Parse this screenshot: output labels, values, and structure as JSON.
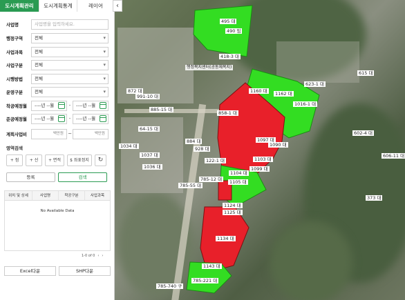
{
  "tabs": [
    {
      "label": "도시계획관리",
      "active": true
    },
    {
      "label": "도시계획통계",
      "active": false
    },
    {
      "label": "레이어",
      "active": false
    }
  ],
  "collapse_icon": "chevron-left-icon",
  "form": {
    "project_name": {
      "label": "사업명",
      "placeholder": "사업명을 입력하세요."
    },
    "district": {
      "label": "행정구역",
      "value": "전체"
    },
    "business_type": {
      "label": "사업과목",
      "value": "전체"
    },
    "business_category": {
      "label": "사업구분",
      "value": "전체"
    },
    "executor": {
      "label": "시행방법",
      "value": "전체"
    },
    "operation": {
      "label": "운영구분",
      "value": "전체"
    },
    "start_date": {
      "label": "착공예정월",
      "from": "----년 --월",
      "to": "----년 --월"
    },
    "completion_date": {
      "label": "준공예정월",
      "from": "----년 --월",
      "to": "----년 --월"
    },
    "budget": {
      "label": "계획사업비",
      "from_suffix": "백만원",
      "to_suffix": "백만원"
    }
  },
  "area_search": {
    "title": "영역검색",
    "buttons": [
      "+ 점",
      "+ 선",
      "+ 면적",
      "$ 좌표정지"
    ],
    "reset_icon": "refresh-icon"
  },
  "actions": {
    "register": "등록",
    "search": "검색"
  },
  "table": {
    "headers": [
      "위치 및 상세",
      "사업명",
      "착공구분",
      "사업과목"
    ],
    "empty": "No Available Data"
  },
  "pager": {
    "info": "1-0 of 0",
    "prev_icon": "chevron-left-icon",
    "next_icon": "chevron-right-icon"
  },
  "export": {
    "excel": "Excel다운",
    "shp": "SHP다운"
  },
  "map": {
    "place_label": "행정복지센터(공동체복지)",
    "parcel_labels": [
      {
        "t": "495 대",
        "id": "p1"
      },
      {
        "t": "490 임",
        "id": "p2"
      },
      {
        "t": "418-3 대",
        "id": "p3"
      },
      {
        "t": "1160 대",
        "id": "p4"
      },
      {
        "t": "1162 대",
        "id": "p5"
      },
      {
        "t": "858-1 대",
        "id": "p6"
      },
      {
        "t": "1099 대",
        "id": "p7"
      },
      {
        "t": "1104 대",
        "id": "p8"
      },
      {
        "t": "1105 대",
        "id": "p9"
      },
      {
        "t": "1124 대",
        "id": "p10"
      },
      {
        "t": "1125 대",
        "id": "p11"
      },
      {
        "t": "1134 대",
        "id": "p12"
      },
      {
        "t": "1143 대",
        "id": "p13"
      },
      {
        "t": "785-221 대",
        "id": "p14"
      },
      {
        "t": "1016-1 대",
        "id": "p15"
      },
      {
        "t": "623-1 대",
        "id": "p16"
      },
      {
        "t": "1090 대",
        "id": "p17"
      },
      {
        "t": "1097 대",
        "id": "p18"
      },
      {
        "t": "872 대",
        "id": "p19"
      },
      {
        "t": "991-10 대",
        "id": "p20"
      },
      {
        "t": "885-15 대",
        "id": "p21"
      },
      {
        "t": "884 대",
        "id": "p22"
      },
      {
        "t": "928 대",
        "id": "p23"
      },
      {
        "t": "1034 대",
        "id": "p24"
      },
      {
        "t": "1037 대",
        "id": "p25"
      },
      {
        "t": "1036 대",
        "id": "p26"
      },
      {
        "t": "785-12 대",
        "id": "p27"
      },
      {
        "t": "785-55 대",
        "id": "p28"
      },
      {
        "t": "615 대",
        "id": "p29"
      },
      {
        "t": "602-4 대",
        "id": "p30"
      },
      {
        "t": "606-11 대",
        "id": "p31"
      },
      {
        "t": "373 대",
        "id": "p32"
      },
      {
        "t": "785-740 구",
        "id": "p33"
      },
      {
        "t": "1103 대",
        "id": "p34"
      },
      {
        "t": "122-1 대",
        "id": "p35"
      },
      {
        "t": "64-15 대",
        "id": "p36"
      }
    ]
  },
  "colors": {
    "accent": "#2a9b52",
    "parcel_red": "#e8202a",
    "parcel_green": "#33dd22"
  }
}
